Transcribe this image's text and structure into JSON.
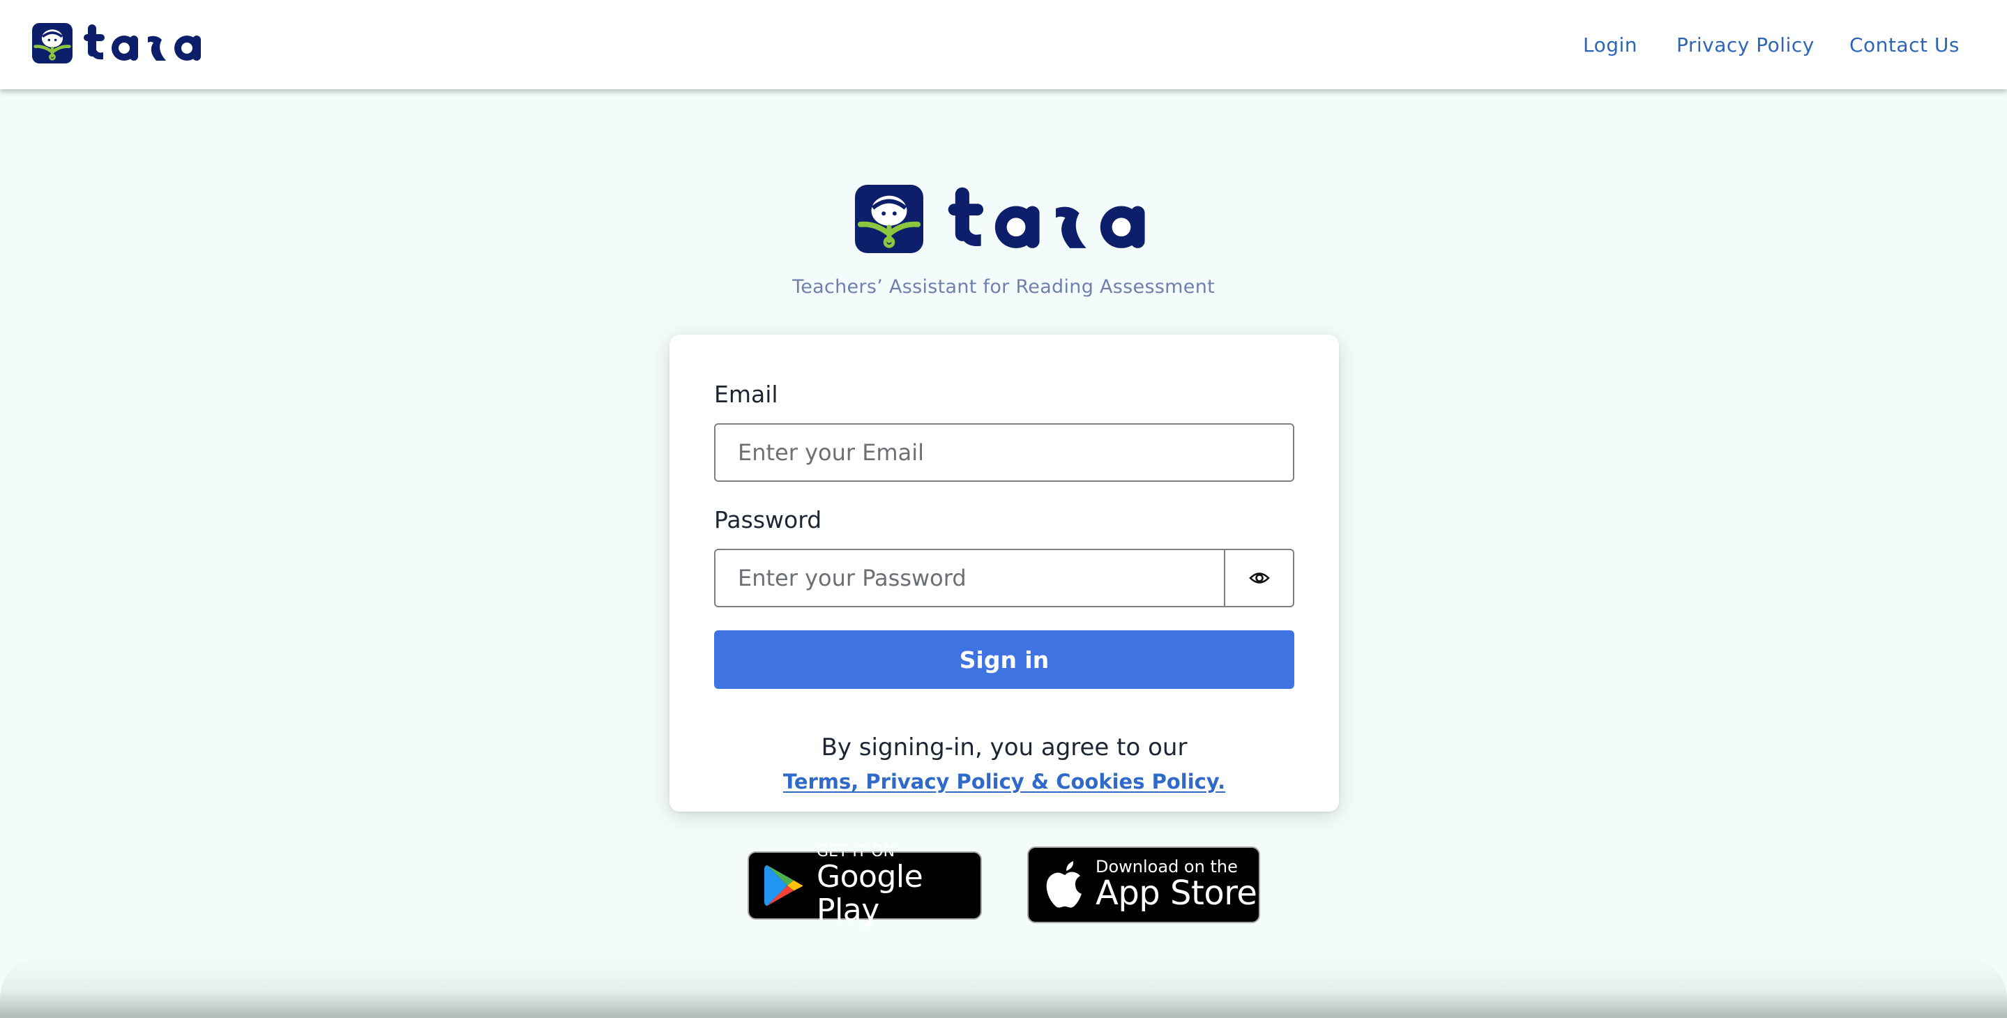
{
  "brand": {
    "name": "tara",
    "tagline": "Teachers’ Assistant for Reading Assessment",
    "colors": {
      "navy": "#0d1f6b",
      "green": "#8cc63f"
    }
  },
  "nav": {
    "login": "Login",
    "privacy": "Privacy Policy",
    "contact": "Contact Us"
  },
  "form": {
    "email_label": "Email",
    "email_placeholder": "Enter your Email",
    "email_value": "",
    "password_label": "Password",
    "password_placeholder": "Enter your Password",
    "password_value": "",
    "toggle_icon": "eye-icon",
    "signin_label": "Sign in",
    "agree_text": "By signing-in, you agree to our",
    "policy_link": "Terms, Privacy Policy & Cookies Policy."
  },
  "badges": {
    "google": {
      "small": "GET IT ON",
      "big": "Google Play"
    },
    "apple": {
      "small": "Download on the",
      "big": "App Store"
    }
  },
  "colors": {
    "accent": "#3f73e2",
    "link": "#2e66b6",
    "background": "#f3fcfa"
  }
}
